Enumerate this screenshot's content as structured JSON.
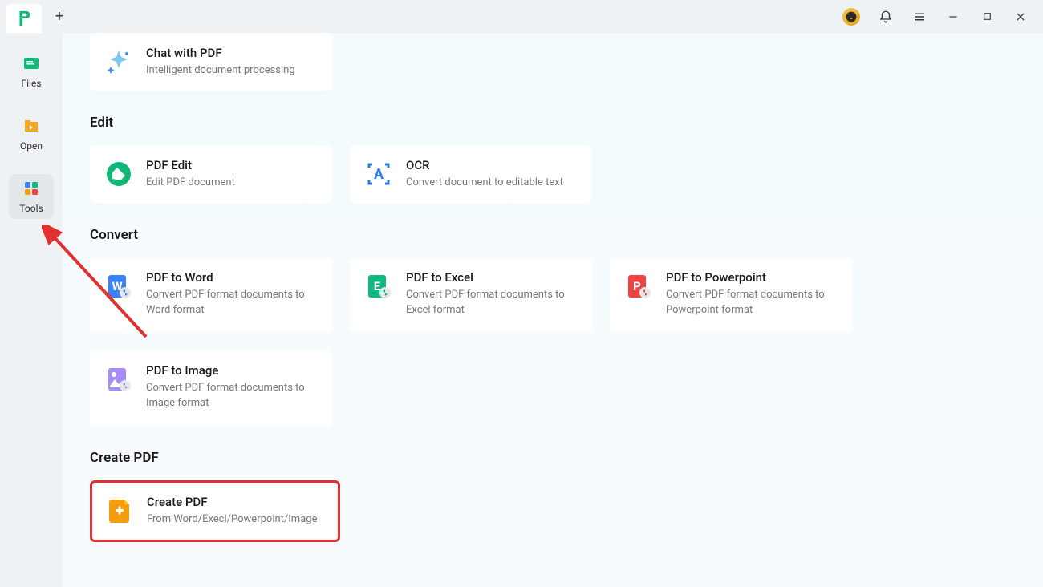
{
  "titlebar": {
    "new_tab": "+"
  },
  "sidebar": {
    "items": [
      {
        "label": "Files"
      },
      {
        "label": "Open"
      },
      {
        "label": "Tools"
      }
    ]
  },
  "chat": {
    "title": "Chat with PDF",
    "desc": "Intelligent document processing"
  },
  "sections": {
    "edit": {
      "title": "Edit",
      "cards": [
        {
          "title": "PDF Edit",
          "desc": "Edit PDF document"
        },
        {
          "title": "OCR",
          "desc": "Convert document to editable text"
        }
      ]
    },
    "convert": {
      "title": "Convert",
      "cards": [
        {
          "title": "PDF to Word",
          "desc": "Convert PDF format documents to Word format"
        },
        {
          "title": "PDF to Excel",
          "desc": "Convert PDF format documents to Excel format"
        },
        {
          "title": "PDF to Powerpoint",
          "desc": "Convert PDF format documents to Powerpoint format"
        },
        {
          "title": "PDF to Image",
          "desc": "Convert PDF format documents to Image format"
        }
      ]
    },
    "create": {
      "title": "Create PDF",
      "cards": [
        {
          "title": "Create PDF",
          "desc": "From Word/Execl/Powerpoint/Image"
        }
      ]
    }
  }
}
